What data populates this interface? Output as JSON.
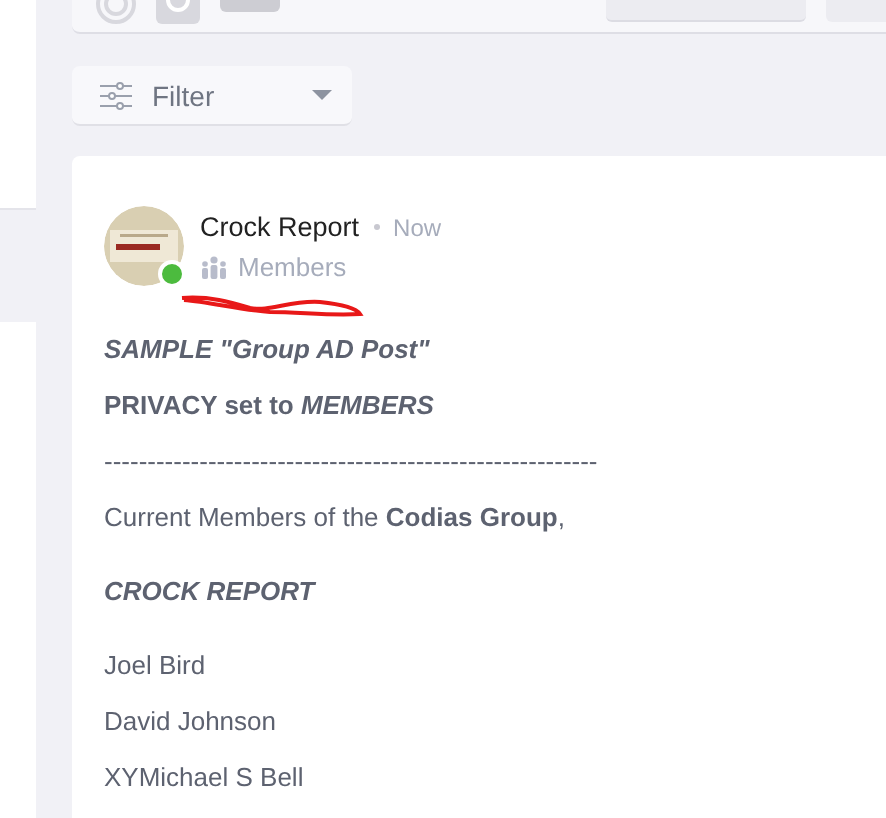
{
  "composer": {
    "tools": [
      {
        "kind": "target"
      },
      {
        "kind": "camera"
      },
      {
        "kind": "gif"
      }
    ]
  },
  "filter": {
    "label": "Filter"
  },
  "post": {
    "author": "Crock Report",
    "online": true,
    "time": "Now",
    "audience": "Members",
    "body": [
      {
        "kind": "emphasis",
        "text": "SAMPLE \"Group AD Post\""
      },
      {
        "kind": "bold",
        "text": "PRIVACY set to *MEMBERS*"
      },
      {
        "kind": "para",
        "text": "---------------------------------------------------------"
      },
      {
        "kind": "para",
        "text": "Current Members of the **Codias Group**,"
      },
      {
        "kind": "emphasis",
        "text": "CROCK REPORT"
      },
      {
        "kind": "para",
        "text": "Joel Bird"
      },
      {
        "kind": "para",
        "text": "David Johnson"
      },
      {
        "kind": "para",
        "text": "XYMichael S Bell"
      }
    ]
  }
}
